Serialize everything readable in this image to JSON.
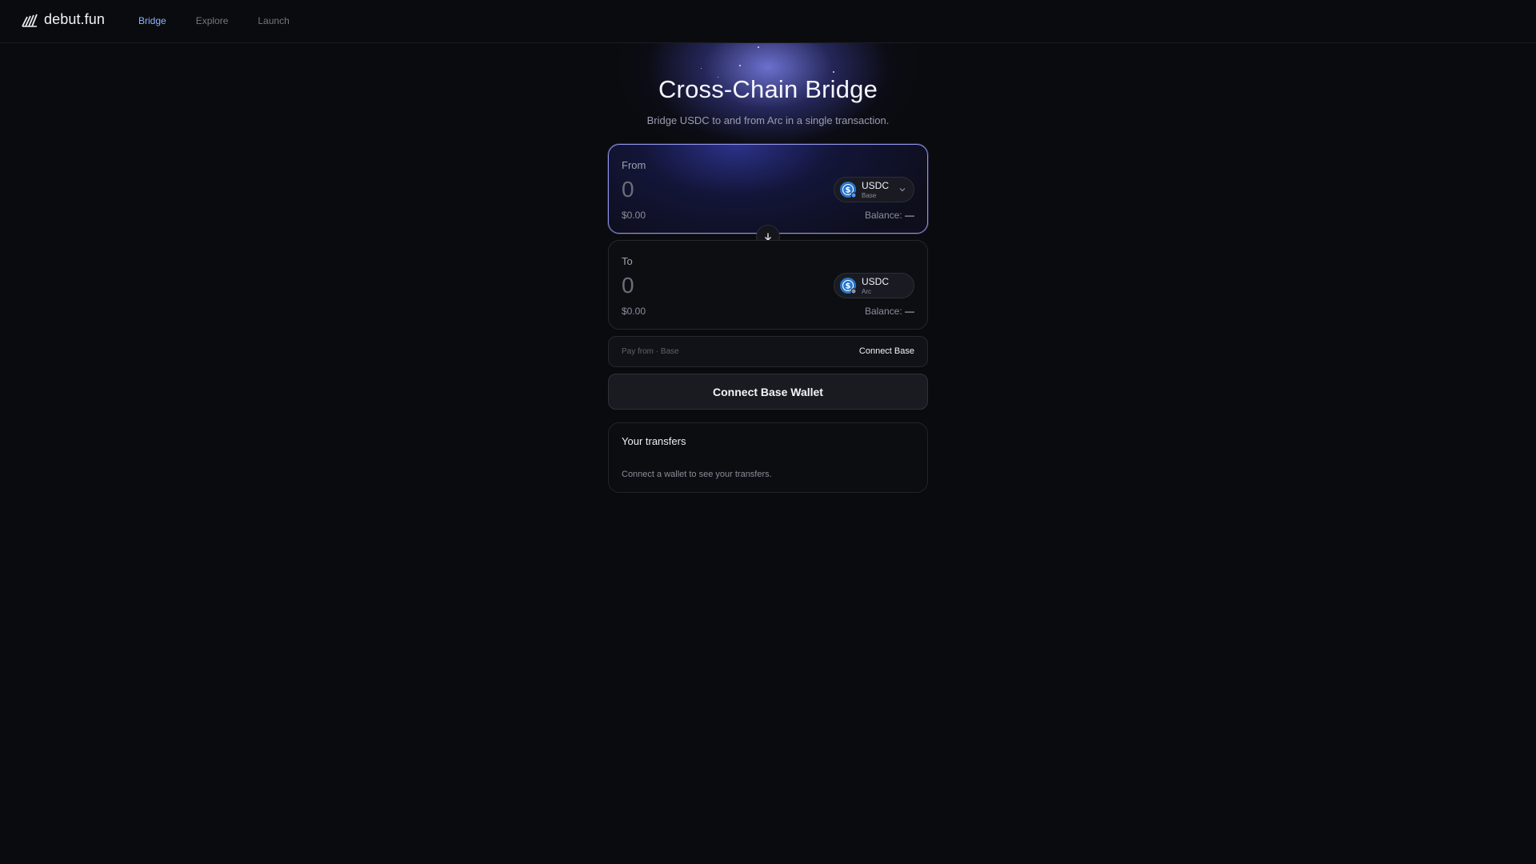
{
  "brand": {
    "name": "debut.fun",
    "logo_icon": "debut-logo-icon"
  },
  "nav": {
    "items": [
      {
        "label": "Bridge",
        "active": true
      },
      {
        "label": "Explore",
        "active": false
      },
      {
        "label": "Launch",
        "active": false
      }
    ]
  },
  "hero": {
    "title": "Cross-Chain Bridge",
    "subtitle": "Bridge USDC to and from Arc in a single transaction."
  },
  "from": {
    "label": "From",
    "amount": "0",
    "usd_value": "$0.00",
    "balance_label": "Balance:",
    "balance_value": "—",
    "token": {
      "symbol": "USDC",
      "chain": "Base",
      "icon": "usdc-icon",
      "chain_badge_icon": "base-chain-icon",
      "has_dropdown": true
    }
  },
  "to": {
    "label": "To",
    "amount": "0",
    "usd_value": "$0.00",
    "balance_label": "Balance:",
    "balance_value": "—",
    "token": {
      "symbol": "USDC",
      "chain": "Arc",
      "icon": "usdc-icon",
      "chain_badge_icon": "arc-chain-icon",
      "has_dropdown": false
    }
  },
  "swap": {
    "icon": "arrow-down-icon"
  },
  "pay": {
    "label": "Pay from · Base",
    "action": "Connect Base"
  },
  "cta": {
    "label": "Connect Base Wallet"
  },
  "transfers": {
    "title": "Your transfers",
    "empty_text": "Connect a wallet to see your transfers."
  },
  "colors": {
    "background": "#0a0b0e",
    "accent_nav": "#8fb4ff",
    "glow": "#7d82f0",
    "usdc_blue": "#2775ca"
  }
}
